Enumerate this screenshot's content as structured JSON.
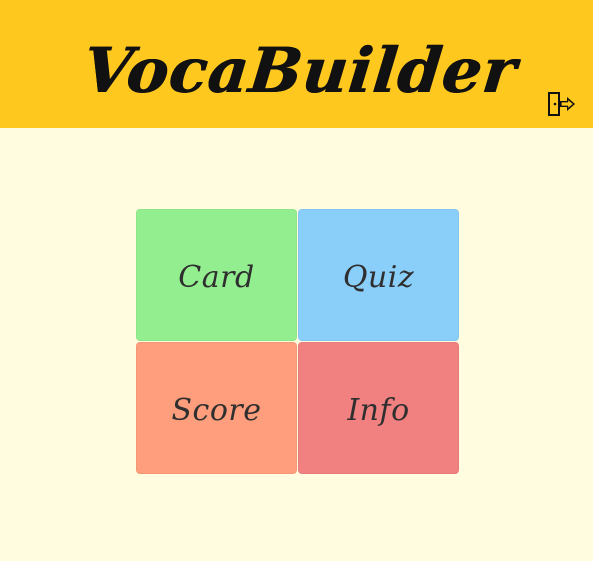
{
  "header": {
    "title": "VocaBuilder",
    "exit_icon": "logout-icon",
    "background": "#FFC81E"
  },
  "menu": {
    "items": [
      {
        "label": "Card",
        "color": "#93EE8F"
      },
      {
        "label": "Quiz",
        "color": "#8ACEFA"
      },
      {
        "label": "Score",
        "color": "#FE9E7C"
      },
      {
        "label": "Info",
        "color": "#F08180"
      }
    ]
  },
  "page": {
    "background": "#FFFCE0"
  }
}
